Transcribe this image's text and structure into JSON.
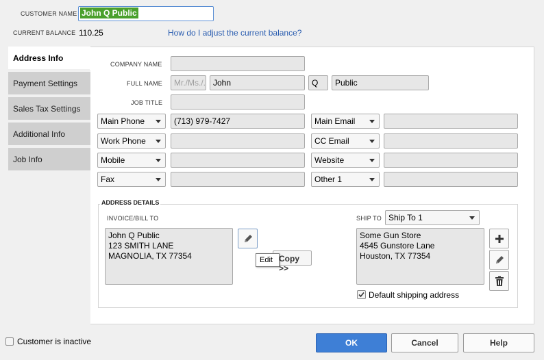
{
  "header": {
    "customer_name_label": "CUSTOMER NAME",
    "customer_name_value": "John Q Public",
    "current_balance_label": "CURRENT BALANCE",
    "current_balance_value": "110.25",
    "adjust_balance_link": "How do I adjust the current balance?"
  },
  "tabs": [
    {
      "label": "Address Info",
      "active": true
    },
    {
      "label": "Payment Settings",
      "active": false
    },
    {
      "label": "Sales Tax Settings",
      "active": false
    },
    {
      "label": "Additional Info",
      "active": false
    },
    {
      "label": "Job Info",
      "active": false
    }
  ],
  "form": {
    "company_name_label": "COMPANY NAME",
    "company_name_value": "",
    "full_name_label": "FULL NAME",
    "title_placeholder": "Mr./Ms./...",
    "first_name": "John",
    "middle_initial": "Q",
    "last_name": "Public",
    "job_title_label": "JOB TITLE",
    "job_title_value": ""
  },
  "contacts_left": [
    {
      "type": "Main Phone",
      "value": "(713) 979-7427"
    },
    {
      "type": "Work Phone",
      "value": ""
    },
    {
      "type": "Mobile",
      "value": ""
    },
    {
      "type": "Fax",
      "value": ""
    }
  ],
  "contacts_right": [
    {
      "type": "Main Email",
      "value": ""
    },
    {
      "type": "CC Email",
      "value": ""
    },
    {
      "type": "Website",
      "value": ""
    },
    {
      "type": "Other 1",
      "value": ""
    }
  ],
  "address": {
    "section_label": "ADDRESS DETAILS",
    "bill_to_label": "INVOICE/BILL TO",
    "bill_to_lines": [
      "John Q Public",
      "123 SMITH LANE",
      "MAGNOLIA, TX 77354"
    ],
    "copy_button": "Copy >>",
    "edit_tooltip": "Edit",
    "ship_to_label": "SHIP TO",
    "ship_to_select": "Ship To 1",
    "ship_to_lines": [
      "Some Gun Store",
      "4545 Gunstore Lane",
      "Houston, TX 77354"
    ],
    "default_shipping_label": "Default shipping address",
    "default_shipping_checked": true
  },
  "footer": {
    "inactive_label": "Customer is inactive",
    "inactive_checked": false,
    "ok_label": "OK",
    "cancel_label": "Cancel",
    "help_label": "Help"
  },
  "colors": {
    "accent": "#3e7fd6",
    "name_highlight": "#4aa02c",
    "link": "#2a5db0"
  }
}
